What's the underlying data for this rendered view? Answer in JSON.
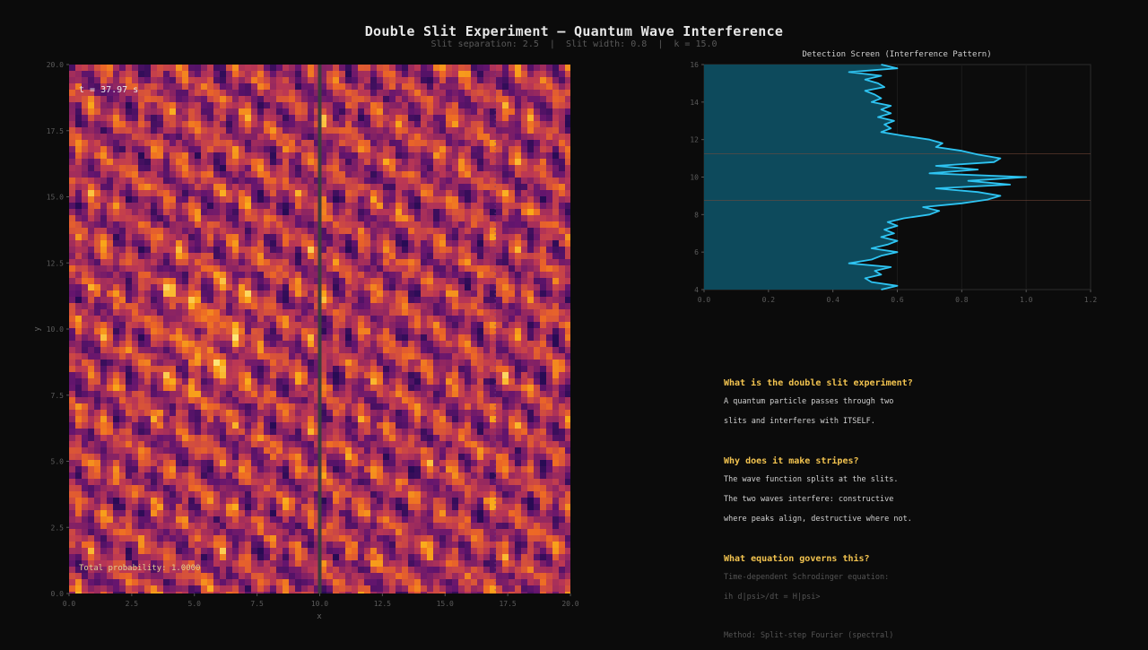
{
  "title": "Double Slit Experiment — Quantum Wave Interference",
  "subtitle": "Slit separation: 2.5  |  Slit width: 0.8  |  k = 15.0",
  "main_plot": {
    "time_label": "t = 37.97 s",
    "probability_label": "Total probability: 1.0000",
    "xlabel": "x",
    "ylabel": "y",
    "xticks": [
      "0.0",
      "2.5",
      "5.0",
      "7.5",
      "10.0",
      "12.5",
      "15.0",
      "17.5",
      "20.0"
    ],
    "yticks": [
      "0.0",
      "2.5",
      "5.0",
      "7.5",
      "10.0",
      "12.5",
      "15.0",
      "17.5",
      "20.0"
    ]
  },
  "chart_data": [
    {
      "type": "heatmap",
      "description_key": "wave probability density |psi|^2",
      "xlim": [
        0,
        20
      ],
      "ylim": [
        0,
        20
      ],
      "barrier_x": 10.0,
      "detector_x": 17.0,
      "colormap": "inferno",
      "xticks": [
        0,
        2.5,
        5,
        7.5,
        10,
        12.5,
        15,
        17.5,
        20
      ],
      "yticks": [
        0,
        2.5,
        5,
        7.5,
        10,
        12.5,
        15,
        17.5,
        20
      ]
    },
    {
      "type": "line",
      "title": "Detection Screen (Interference Pattern)",
      "orientation": "horizontal-values",
      "xlim": [
        0,
        1.2
      ],
      "ylim": [
        4,
        16
      ],
      "xticks": [
        0.0,
        0.2,
        0.4,
        0.6,
        0.8,
        1.0,
        1.2
      ],
      "yticks": [
        4,
        6,
        8,
        10,
        12,
        14,
        16
      ],
      "slit_lines_y": [
        8.75,
        11.25
      ],
      "line_color": "#2ec4f2",
      "fill_color": "#0d4a5c",
      "points": [
        [
          4.0,
          0.55
        ],
        [
          4.2,
          0.6
        ],
        [
          4.4,
          0.52
        ],
        [
          4.6,
          0.5
        ],
        [
          4.8,
          0.55
        ],
        [
          5.0,
          0.53
        ],
        [
          5.2,
          0.58
        ],
        [
          5.4,
          0.45
        ],
        [
          5.6,
          0.52
        ],
        [
          5.8,
          0.55
        ],
        [
          6.0,
          0.6
        ],
        [
          6.2,
          0.52
        ],
        [
          6.4,
          0.57
        ],
        [
          6.6,
          0.6
        ],
        [
          6.8,
          0.55
        ],
        [
          7.0,
          0.59
        ],
        [
          7.2,
          0.56
        ],
        [
          7.4,
          0.6
        ],
        [
          7.6,
          0.57
        ],
        [
          7.8,
          0.62
        ],
        [
          8.0,
          0.7
        ],
        [
          8.2,
          0.73
        ],
        [
          8.4,
          0.68
        ],
        [
          8.6,
          0.8
        ],
        [
          8.8,
          0.88
        ],
        [
          9.0,
          0.92
        ],
        [
          9.2,
          0.85
        ],
        [
          9.4,
          0.72
        ],
        [
          9.6,
          0.95
        ],
        [
          9.8,
          0.82
        ],
        [
          10.0,
          1.0
        ],
        [
          10.2,
          0.7
        ],
        [
          10.4,
          0.85
        ],
        [
          10.6,
          0.72
        ],
        [
          10.8,
          0.9
        ],
        [
          11.0,
          0.92
        ],
        [
          11.2,
          0.85
        ],
        [
          11.4,
          0.8
        ],
        [
          11.6,
          0.72
        ],
        [
          11.8,
          0.74
        ],
        [
          12.0,
          0.7
        ],
        [
          12.2,
          0.62
        ],
        [
          12.4,
          0.55
        ],
        [
          12.6,
          0.58
        ],
        [
          12.8,
          0.56
        ],
        [
          13.0,
          0.59
        ],
        [
          13.2,
          0.54
        ],
        [
          13.4,
          0.58
        ],
        [
          13.6,
          0.55
        ],
        [
          13.8,
          0.58
        ],
        [
          14.0,
          0.52
        ],
        [
          14.2,
          0.55
        ],
        [
          14.4,
          0.53
        ],
        [
          14.6,
          0.5
        ],
        [
          14.8,
          0.56
        ],
        [
          15.0,
          0.54
        ],
        [
          15.2,
          0.5
        ],
        [
          15.4,
          0.55
        ],
        [
          15.6,
          0.45
        ],
        [
          15.8,
          0.6
        ],
        [
          16.0,
          0.55
        ]
      ]
    }
  ],
  "info": [
    {
      "q": "What is the double slit experiment?",
      "lines": [
        "A quantum particle passes through two",
        "slits and interferes with ITSELF."
      ]
    },
    {
      "q": "Why does it make stripes?",
      "lines": [
        "The wave function splits at the slits.",
        "The two waves interfere: constructive",
        "where peaks align, destructive where not."
      ]
    },
    {
      "q": "What equation governs this?",
      "lines": [
        "Time-dependent Schrodinger equation:",
        "ih d|psi>/dt = H|psi>"
      ]
    }
  ],
  "method": "Method: Split-step Fourier (spectral)"
}
